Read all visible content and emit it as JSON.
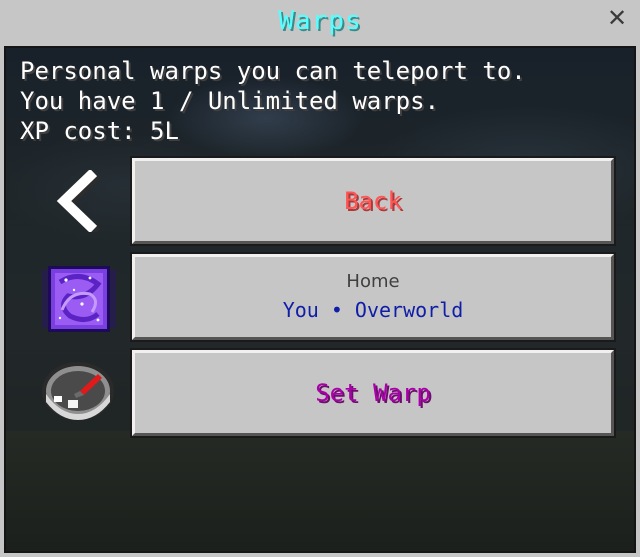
{
  "window": {
    "title": "Warps",
    "close_symbol": "✕",
    "title_color": "#55ffff"
  },
  "info": {
    "line1": "Personal warps you can teleport to.",
    "line2": "You have 1 / Unlimited warps.",
    "line3": "XP cost: 5L"
  },
  "buttons": {
    "back": {
      "label": "Back",
      "icon": "chevron-left-icon",
      "color": "#ff5555"
    },
    "home": {
      "name": "Home",
      "subtitle": "You • Overworld",
      "icon": "nether-portal-icon",
      "subtitle_color": "#0f1ea8"
    },
    "set_warp": {
      "label": "Set Warp",
      "icon": "compass-icon",
      "color": "#aa00aa"
    }
  }
}
